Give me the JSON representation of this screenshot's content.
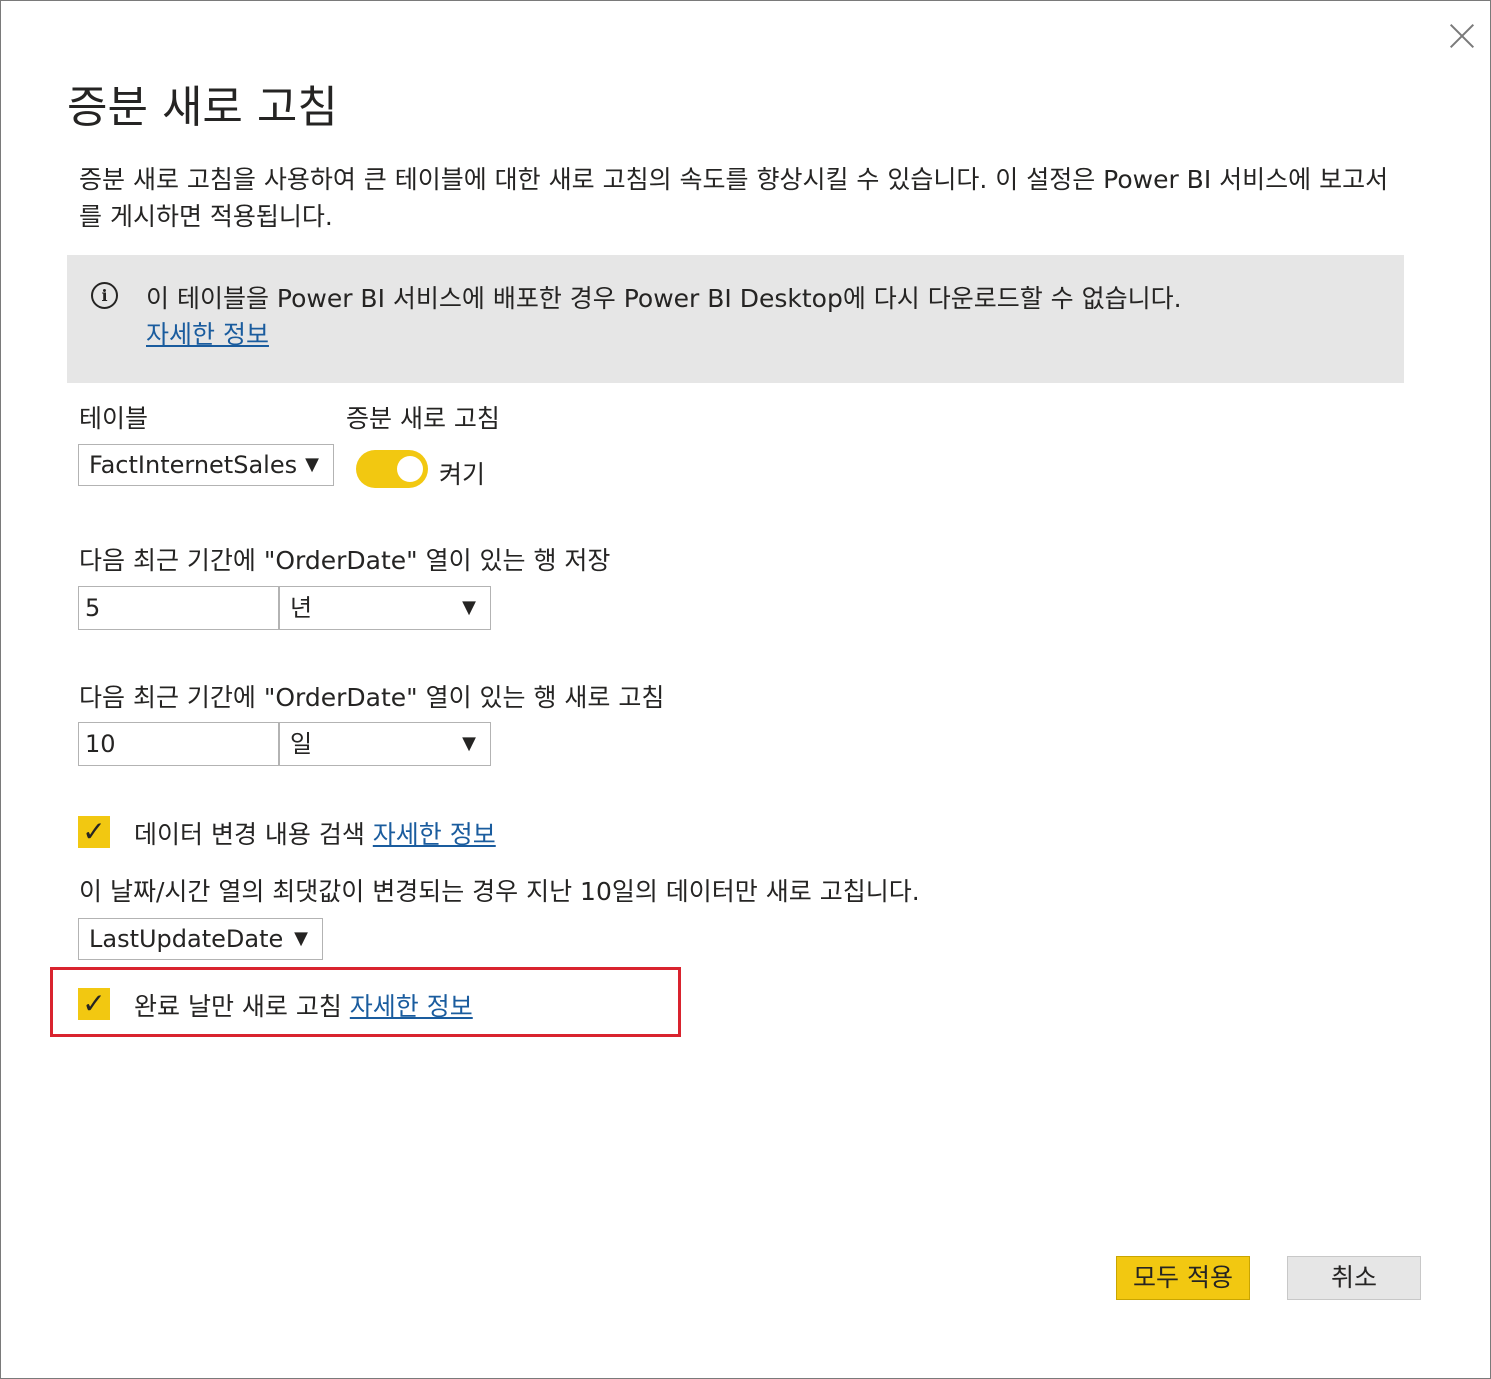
{
  "dialog": {
    "title": "증분 새로 고침",
    "description": "증분 새로 고침을 사용하여 큰 테이블에 대한 새로 고침의 속도를 향상시킬 수 있습니다. 이 설정은 Power BI 서비스에 보고서를 게시하면 적용됩니다.",
    "close_icon": "close-icon"
  },
  "info_banner": {
    "icon": "info-icon",
    "text": "이 테이블을 Power BI 서비스에 배포한 경우 Power BI Desktop에 다시 다운로드할 수 없습니다.",
    "link": "자세한 정보"
  },
  "table_section": {
    "label": "테이블",
    "selected": "FactInternetSales"
  },
  "incremental_section": {
    "label": "증분 새로 고침",
    "toggle_state": "켜기",
    "toggle_on": true
  },
  "store_section": {
    "label": "다음 최근 기간에 \"OrderDate\" 열이 있는 행 저장",
    "value": "5",
    "unit": "년"
  },
  "refresh_section": {
    "label": "다음 최근 기간에 \"OrderDate\" 열이 있는 행 새로 고침",
    "value": "10",
    "unit": "일"
  },
  "detect_changes": {
    "checked": true,
    "label": "데이터 변경 내용 검색",
    "link": "자세한 정보",
    "note": "이 날짜/시간 열의 최댓값이 변경되는 경우 지난 10일의 데이터만 새로 고칩니다.",
    "column_selected": "LastUpdateDate"
  },
  "complete_days": {
    "checked": true,
    "label": "완료 날만 새로 고침",
    "link": "자세한 정보"
  },
  "buttons": {
    "apply_all": "모두 적용",
    "cancel": "취소"
  },
  "colors": {
    "accent": "#f2c811",
    "link": "#1a5c9e",
    "highlight_border": "#d9232e",
    "banner_bg": "#e6e6e6"
  }
}
